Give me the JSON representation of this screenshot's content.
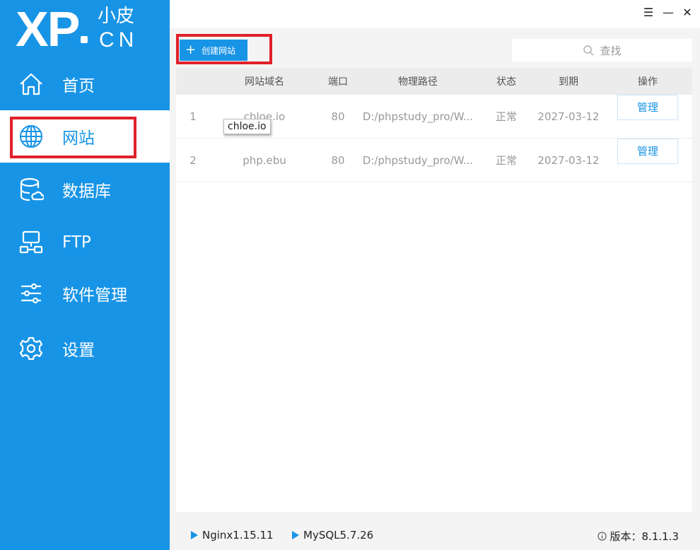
{
  "logo": {
    "main": "XP",
    "top": "小皮",
    "bottom": "CN"
  },
  "window_controls": {
    "menu": "☰",
    "minimize": "—",
    "close": "✕"
  },
  "sidebar": {
    "items": [
      {
        "label": "首页",
        "icon": "home-icon"
      },
      {
        "label": "网站",
        "icon": "globe-icon",
        "active": true
      },
      {
        "label": "数据库",
        "icon": "database-icon"
      },
      {
        "label": "FTP",
        "icon": "ftp-icon"
      },
      {
        "label": "软件管理",
        "icon": "sliders-icon"
      },
      {
        "label": "设置",
        "icon": "gear-icon"
      }
    ]
  },
  "toolbar": {
    "create_label": "创建网站",
    "search_placeholder": "查找"
  },
  "table": {
    "columns": [
      "网站域名",
      "端口",
      "物理路径",
      "状态",
      "到期",
      "操作"
    ],
    "rows": [
      {
        "index": "1",
        "domain": "chloe.io",
        "port": "80",
        "path": "D:/phpstudy_pro/W...",
        "status": "正常",
        "expiry": "2027-03-12",
        "action": "管理"
      },
      {
        "index": "2",
        "domain": "php.ebu",
        "port": "80",
        "path": "D:/phpstudy_pro/W...",
        "status": "正常",
        "expiry": "2027-03-12",
        "action": "管理"
      }
    ]
  },
  "tooltip": "chloe.io",
  "footer": {
    "nginx": "Nginx1.15.11",
    "mysql": "MySQL5.7.26",
    "version_label": "版本：",
    "version": "8.1.1.3"
  },
  "colors": {
    "primary": "#1894e6",
    "highlight": "#e0202a"
  }
}
